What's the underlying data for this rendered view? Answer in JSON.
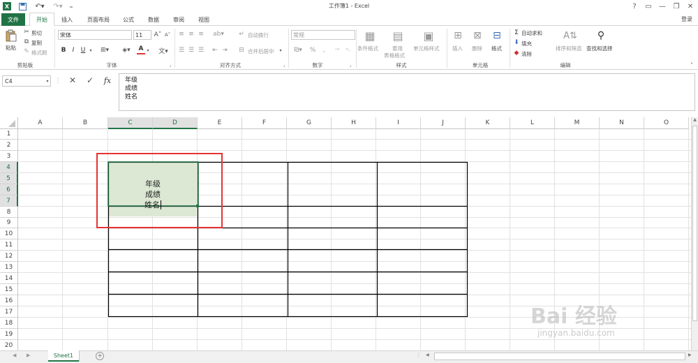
{
  "window": {
    "title": "工作簿1 - Excel",
    "help": "?",
    "login": "登录"
  },
  "tabs": [
    "文件",
    "开始",
    "插入",
    "页面布局",
    "公式",
    "数据",
    "审阅",
    "视图"
  ],
  "ribbon": {
    "clipboard": {
      "paste": "粘贴",
      "cut": "剪切",
      "copy": "复制",
      "format_painter": "格式刷",
      "label": "剪贴板"
    },
    "font": {
      "name": "宋体",
      "size": "11",
      "bold": "B",
      "italic": "I",
      "underline": "U",
      "color_btn": "A",
      "label": "字体"
    },
    "alignment": {
      "wrap": "自动换行",
      "merge": "合并后居中",
      "label": "对齐方式"
    },
    "number": {
      "format": "常规",
      "percent": "%",
      "comma": ",",
      "label": "数字"
    },
    "styles": {
      "conditional": "条件格式",
      "table_line1": "套用",
      "table_line2": "表格格式",
      "cell_styles": "单元格样式",
      "label": "样式"
    },
    "cells": {
      "insert": "插入",
      "delete": "删除",
      "format": "格式",
      "label": "单元格"
    },
    "editing": {
      "autosum": "自动求和",
      "fill": "填充",
      "clear": "清除",
      "sort": "排序和筛选",
      "find": "查找和选择",
      "label": "编辑"
    }
  },
  "formula_bar": {
    "name_box": "C4",
    "cancel": "✕",
    "enter": "✓",
    "fx": "fx",
    "lines": [
      "年级",
      "成绩",
      "姓名"
    ]
  },
  "columns": [
    "A",
    "B",
    "C",
    "D",
    "E",
    "F",
    "G",
    "H",
    "I",
    "J",
    "K",
    "L",
    "M",
    "N",
    "O"
  ],
  "selected_columns": [
    "C",
    "D"
  ],
  "rows": [
    "1",
    "2",
    "3",
    "4",
    "5",
    "6",
    "7",
    "8",
    "9",
    "10",
    "11",
    "12",
    "13",
    "14",
    "15",
    "16",
    "17",
    "18",
    "19",
    "20"
  ],
  "selected_rows": [
    "4",
    "5",
    "6",
    "7"
  ],
  "active_cell": {
    "ref": "C4",
    "lines": [
      "年级",
      "成绩",
      "姓名"
    ]
  },
  "sheets": [
    "Sheet1"
  ],
  "watermark": {
    "brand": "Bai 经验",
    "url": "jingyan.baidu.com"
  },
  "colors": {
    "excel_green": "#217346",
    "selection_fill": "#dce8d4",
    "highlight_box": "#e53333"
  }
}
